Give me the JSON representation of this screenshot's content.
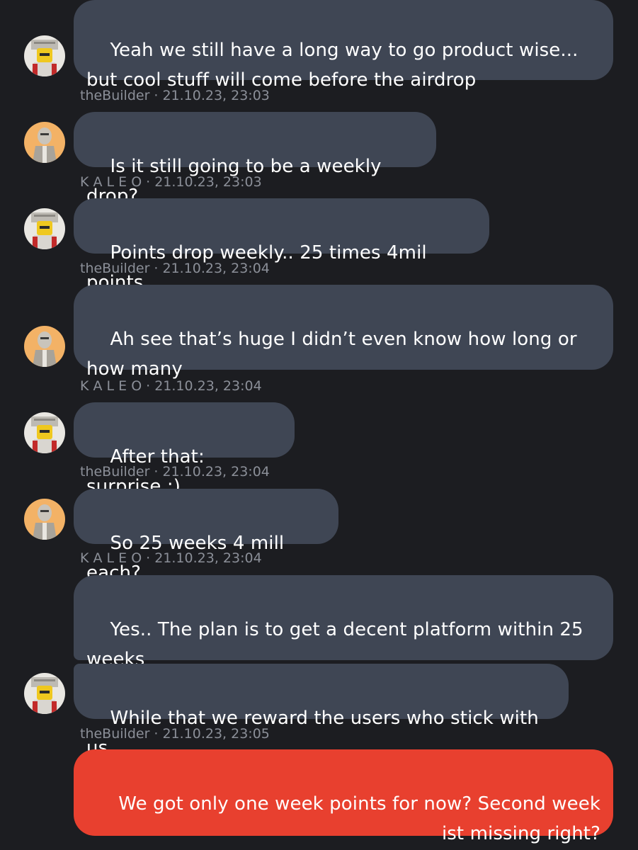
{
  "messages": [
    {
      "text": "Yeah we still have a long way to go product wise...\nbut cool stuff will come before the airdrop",
      "author": "theBuilder",
      "time": "21.10.23, 23:03"
    },
    {
      "text": "Is it still going to be a weekly drop?",
      "author": "K A L E O",
      "time": "21.10.23, 23:03"
    },
    {
      "text": "Points drop weekly.. 25 times 4mil points",
      "author": "theBuilder",
      "time": "21.10.23, 23:04"
    },
    {
      "text": "Ah see that’s huge I didn’t even know how long or\nhow many",
      "author": "K A L E O",
      "time": "21.10.23, 23:04"
    },
    {
      "text": "After that: surprise :)",
      "author": "theBuilder",
      "time": "21.10.23, 23:04"
    },
    {
      "text": "So 25 weeks 4 mill each?",
      "author": "K A L E O",
      "time": "21.10.23, 23:04"
    },
    {
      "text": "Yes.. The plan is to get a decent platform within 25\nweeks"
    },
    {
      "text": "While that we reward the users who stick with us",
      "author": "theBuilder",
      "time": "21.10.23, 23:05"
    },
    {
      "text": "We got only one week points for now? Second week\nist missing right?"
    }
  ],
  "meta_separator": "·",
  "colors": {
    "background": "#1c1d21",
    "incoming_bubble": "#3f4654",
    "outgoing_bubble": "#e8402f",
    "meta_text": "#8b8f98"
  },
  "avatars": {
    "builder": "knight-avatar-icon",
    "kaleo": "orange-character-avatar-icon"
  }
}
